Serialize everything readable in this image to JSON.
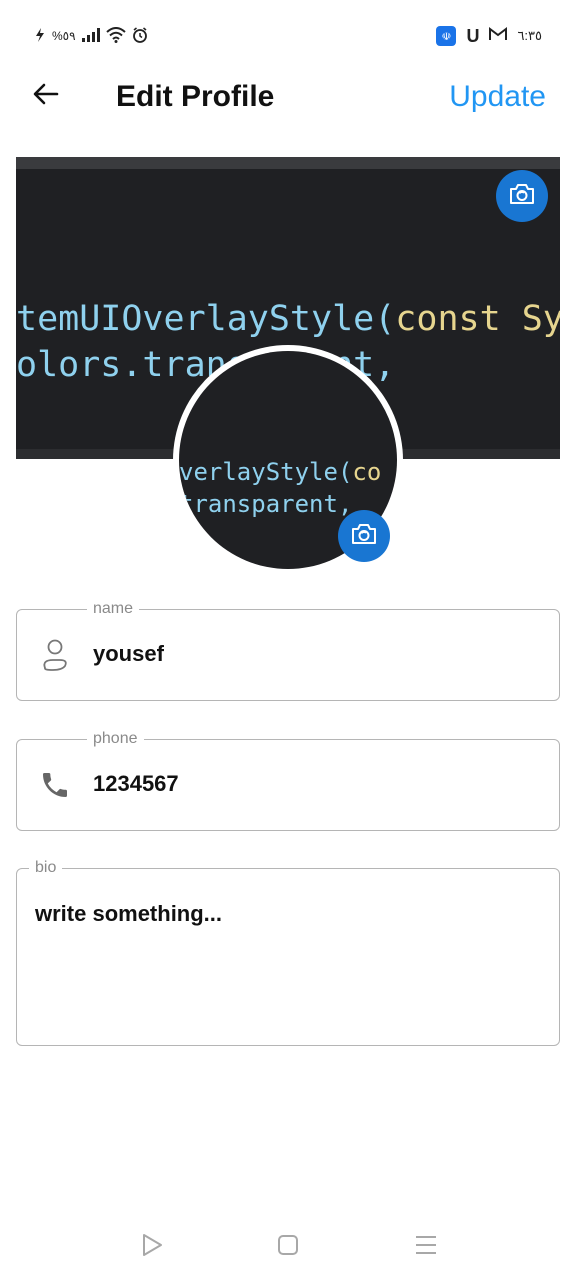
{
  "status_bar": {
    "left_text": "%٥٩",
    "time": "٦:٣٥",
    "icons": [
      "charging-icon",
      "signal-icon",
      "wifi-icon",
      "alarm-icon",
      "app-badge-icon",
      "u-app-icon",
      "gmail-icon"
    ]
  },
  "app_bar": {
    "title": "Edit Profile",
    "update_label": "Update"
  },
  "cover": {
    "code_line_1_a": "temUIOverlayStyle(",
    "code_line_1_b": "const Sy",
    "code_line_2": "olors.transparent,"
  },
  "avatar": {
    "code_line_1_a": "verlayStyle(",
    "code_line_1_b": "co",
    "code_line_2": "transparent,"
  },
  "form": {
    "name": {
      "label": "name",
      "value": "yousef"
    },
    "phone": {
      "label": "phone",
      "value": "1234567"
    },
    "bio": {
      "label": "bio",
      "value": "write something..."
    }
  },
  "colors": {
    "accent": "#2196f3",
    "camera_button": "#1976d2",
    "code_background": "#1f2023",
    "border": "#b5b5b5"
  }
}
